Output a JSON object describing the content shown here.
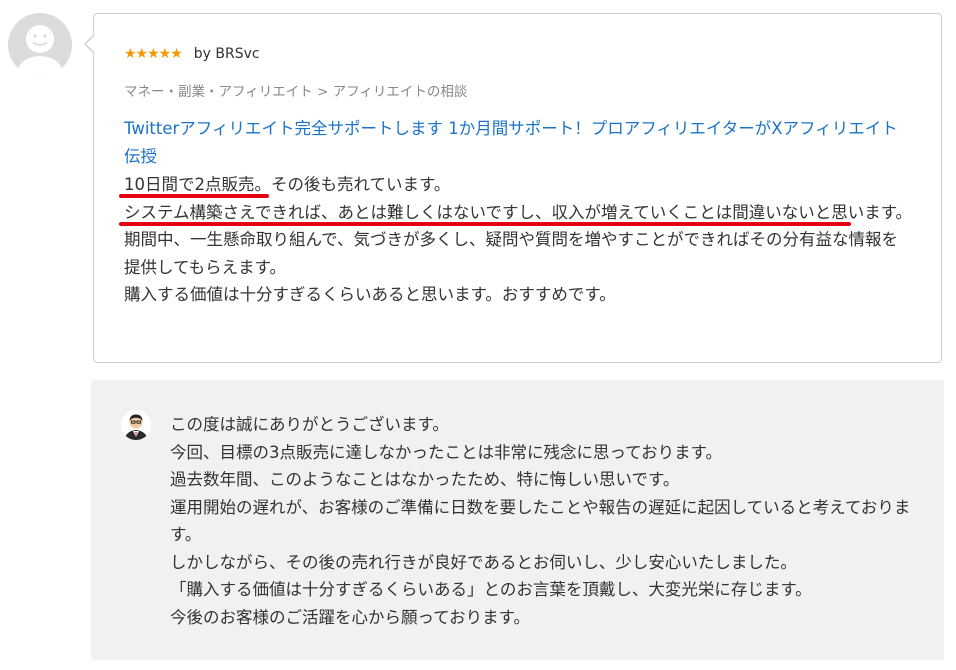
{
  "review": {
    "stars": "★★★★★",
    "reviewer": "by BRSvc",
    "category": "マネー・副業・アフィリエイト > アフィリエイトの相談",
    "service_title": "Twitterアフィリエイト完全サポートします 1か月間サポート！プロアフィリエイターがXアフィリエイト伝授",
    "body_lines": [
      "10日間で2点販売。その後も売れています。",
      "システム構築さえできれば、あとは難しくはないですし、収入が増えていくことは間違いないと思います。",
      "期間中、一生懸命取り組んで、気づきが多くし、疑問や質問を増やすことができればその分有益な情報を提供してもらえます。",
      "購入する価値は十分すぎるくらいあると思います。おすすめです。"
    ],
    "star_color": "#f39800",
    "link_color": "#1a73c8",
    "highlight_color": "#e50012"
  },
  "reply": {
    "lines": [
      "この度は誠にありがとうございます。",
      "今回、目標の3点販売に達しなかったことは非常に残念に思っております。",
      "過去数年間、このようなことはなかったため、特に悔しい思いです。",
      "運用開始の遅れが、お客様のご準備に日数を要したことや報告の遅延に起因していると考えております。",
      "しかしながら、その後の売れ行きが良好であるとお伺いし、少し安心いたしました。",
      "「購入する価値は十分すぎるくらいある」とのお言葉を頂戴し、大変光栄に存じます。",
      "今後のお客様のご活躍を心から願っております。"
    ],
    "background_color": "#f0f1f3"
  }
}
